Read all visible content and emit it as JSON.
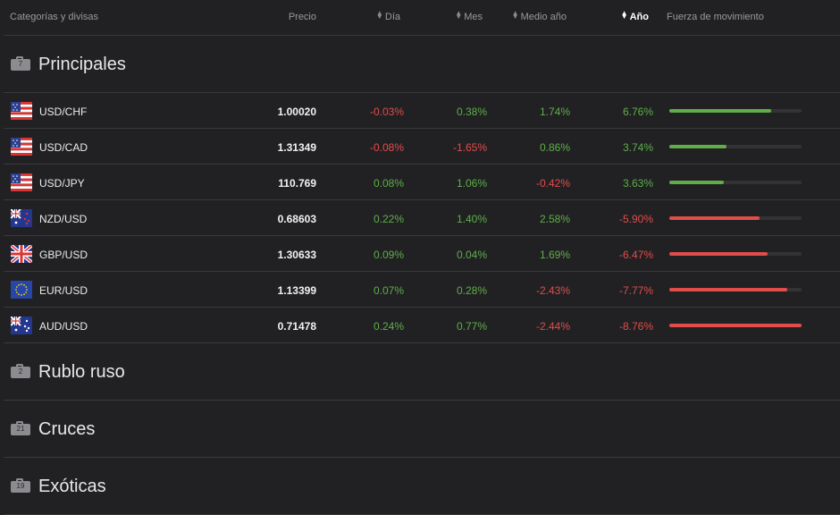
{
  "header": {
    "categories": "Categorías y divisas",
    "price": "Precio",
    "day": "Día",
    "month": "Mes",
    "half_year": "Medio año",
    "year": "Año",
    "strength": "Fuerza de movimiento"
  },
  "categories": [
    {
      "name": "Principales",
      "count": "7"
    },
    {
      "name": "Rublo ruso",
      "count": "2"
    },
    {
      "name": "Cruces",
      "count": "21"
    },
    {
      "name": "Exóticas",
      "count": "19"
    }
  ],
  "rows": [
    {
      "pair": "USD/CHF",
      "flag": "us-flag",
      "price": "1.00020",
      "day": "-0.03%",
      "month": "0.38%",
      "half_year": "1.74%",
      "year": "6.76%",
      "strength": 0.77,
      "trend": "up"
    },
    {
      "pair": "USD/CAD",
      "flag": "us-flag",
      "price": "1.31349",
      "day": "-0.08%",
      "month": "-1.65%",
      "half_year": "0.86%",
      "year": "3.74%",
      "strength": 0.43,
      "trend": "up"
    },
    {
      "pair": "USD/JPY",
      "flag": "us-flag",
      "price": "110.769",
      "day": "0.08%",
      "month": "1.06%",
      "half_year": "-0.42%",
      "year": "3.63%",
      "strength": 0.41,
      "trend": "up"
    },
    {
      "pair": "NZD/USD",
      "flag": "nz-flag",
      "price": "0.68603",
      "day": "0.22%",
      "month": "1.40%",
      "half_year": "2.58%",
      "year": "-5.90%",
      "strength": 0.68,
      "trend": "down"
    },
    {
      "pair": "GBP/USD",
      "flag": "gb-flag",
      "price": "1.30633",
      "day": "0.09%",
      "month": "0.04%",
      "half_year": "1.69%",
      "year": "-6.47%",
      "strength": 0.74,
      "trend": "down"
    },
    {
      "pair": "EUR/USD",
      "flag": "eu-flag",
      "price": "1.13399",
      "day": "0.07%",
      "month": "0.28%",
      "half_year": "-2.43%",
      "year": "-7.77%",
      "strength": 0.89,
      "trend": "down"
    },
    {
      "pair": "AUD/USD",
      "flag": "au-flag",
      "price": "0.71478",
      "day": "0.24%",
      "month": "0.77%",
      "half_year": "-2.44%",
      "year": "-8.76%",
      "strength": 1.0,
      "trend": "down"
    }
  ],
  "colors": {
    "up": "#5fae4a",
    "down": "#e24c4b",
    "background": "#212123"
  }
}
